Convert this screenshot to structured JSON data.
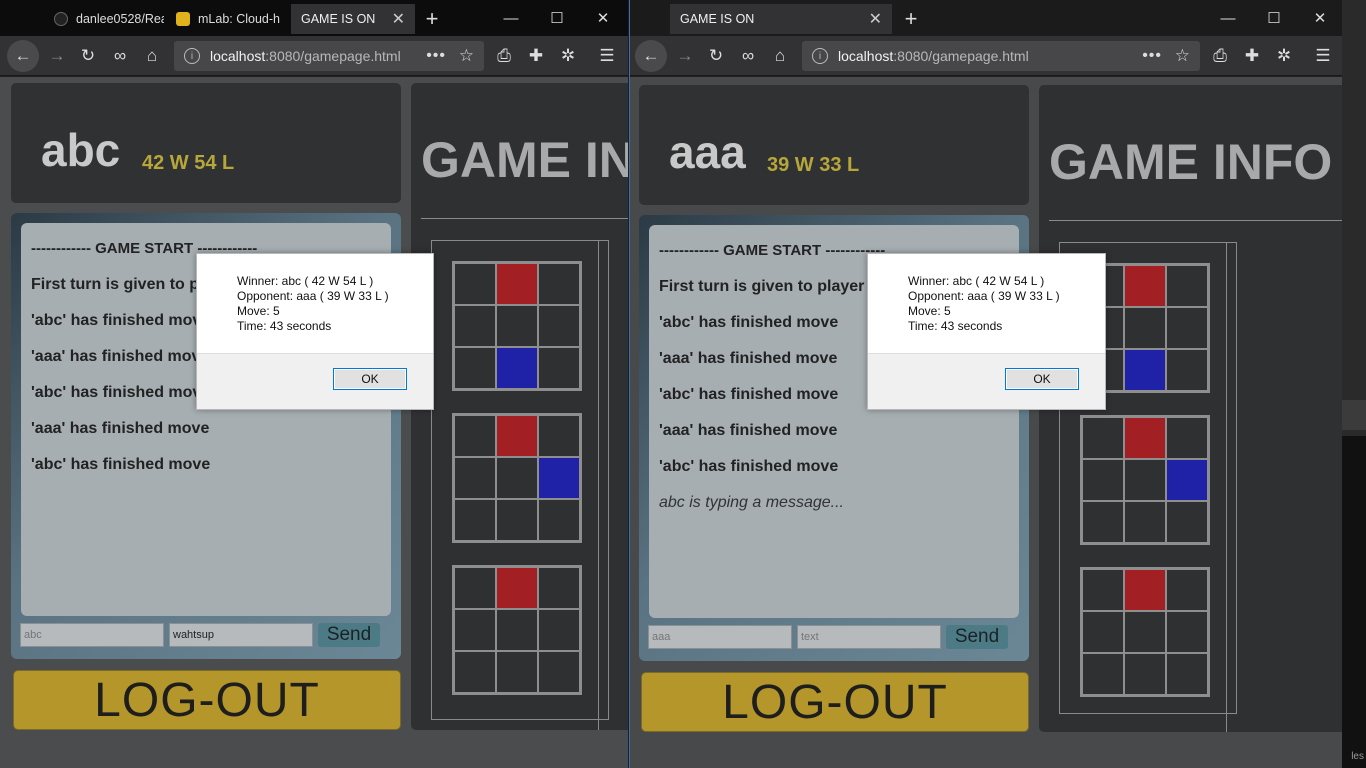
{
  "left": {
    "tabs": [
      {
        "label": "danlee0528/Rea"
      },
      {
        "label": "mLab: Cloud-h"
      },
      {
        "label": "GAME IS ON"
      }
    ],
    "url": {
      "host": "localhost",
      "path": ":8080/gamepage.html"
    },
    "player": {
      "name": "abc",
      "record": "42 W 54 L"
    },
    "info_title": "GAME INFO",
    "chat": [
      "------------ GAME START ------------",
      "First turn is given to player",
      "'abc' has finished move",
      "'aaa' has finished move",
      "'abc' has finished move",
      "'aaa' has finished move",
      "'abc' has finished move"
    ],
    "name_input": {
      "placeholder": "abc"
    },
    "message_input": {
      "value": "wahtsup"
    },
    "send_label": "Send",
    "logout_label": "LOG-OUT"
  },
  "right": {
    "tabs": [
      {
        "label": "GAME IS ON"
      }
    ],
    "url": {
      "host": "localhost",
      "path": ":8080/gamepage.html"
    },
    "player": {
      "name": "aaa",
      "record": "39 W 33 L"
    },
    "info_title": "GAME INFO",
    "chat": [
      "------------ GAME START ------------",
      "First turn is given to player",
      "'abc' has finished move",
      "'aaa' has finished move",
      "'abc' has finished move",
      "'aaa' has finished move",
      "'abc' has finished move",
      "abc is typing a message..."
    ],
    "name_input": {
      "placeholder": "aaa"
    },
    "message_input": {
      "placeholder": "text"
    },
    "send_label": "Send",
    "logout_label": "LOG-OUT"
  },
  "boards": [
    [
      "",
      "red",
      "",
      "",
      "",
      "",
      "",
      "blue",
      ""
    ],
    [
      "",
      "red",
      "",
      "",
      "",
      "blue",
      "",
      "",
      ""
    ],
    [
      "",
      "red",
      "",
      "",
      "",
      "",
      "",
      "",
      ""
    ]
  ],
  "dialog": {
    "lines": [
      "Winner: abc ( 42 W 54 L  )",
      "Opponent: aaa ( 39 W 33 L  )",
      "Move: 5",
      "Time: 43 seconds"
    ],
    "ok_label": "OK"
  },
  "desktop": {
    "peek_text": "les"
  },
  "colors": {
    "red_piece": "#a21f24",
    "blue_piece": "#1f22a6",
    "record": "#b7a73a",
    "logout": "#b5962b"
  }
}
